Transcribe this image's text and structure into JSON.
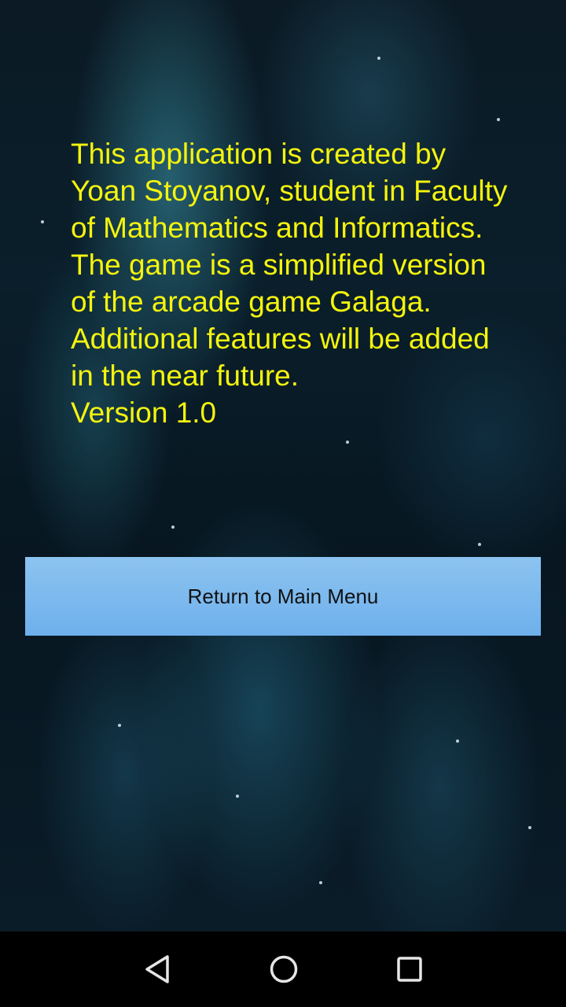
{
  "about": {
    "lines": [
      "This application is created by",
      "Yoan Stoyanov, student in Faculty",
      "of Mathematics and Informatics.",
      "The game is a simplified version",
      "of the arcade game Galaga.",
      "Additional features will be added",
      "in the near future.",
      "Version 1.0"
    ],
    "text_color": "#f4f40e"
  },
  "button": {
    "label": "Return to Main Menu",
    "color": "#7ab8ee"
  },
  "nav_bar": {
    "back_icon": "back-triangle-icon",
    "home_icon": "home-circle-icon",
    "recents_icon": "recents-square-icon"
  }
}
